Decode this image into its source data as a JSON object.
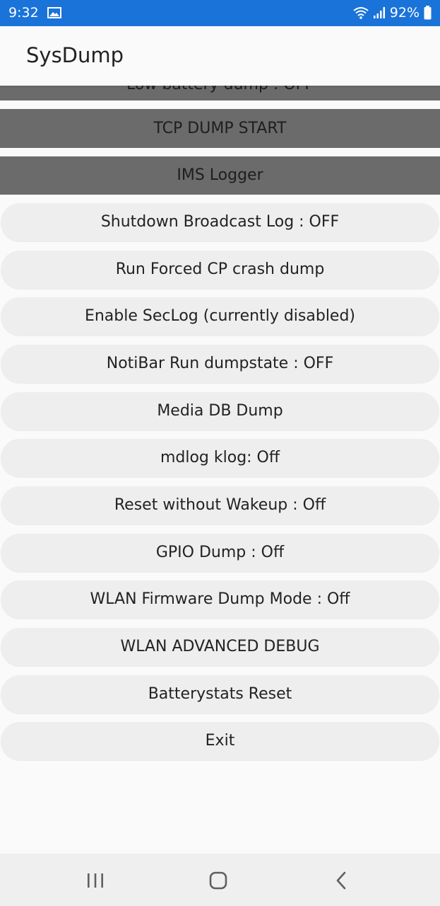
{
  "status_bar": {
    "time": "9:32",
    "battery_percent": "92%",
    "icons": [
      "photo-icon",
      "wifi-icon",
      "signal-icon",
      "battery-icon"
    ],
    "background": "#1a73d9"
  },
  "app_bar": {
    "title": "SysDump"
  },
  "buttons": {
    "low_battery": "Low battery dump : OFF",
    "tcp_dump": "TCP DUMP START",
    "ims_logger": "IMS Logger"
  },
  "pill_buttons": [
    "Shutdown Broadcast Log : OFF",
    "Run Forced CP crash dump",
    "Enable SecLog (currently disabled)",
    "NotiBar Run dumpstate : OFF",
    "Media DB Dump",
    "mdlog klog: Off",
    "Reset without Wakeup : Off",
    "GPIO Dump : Off",
    "WLAN Firmware Dump Mode : Off",
    "WLAN ADVANCED DEBUG",
    "Batterystats Reset",
    "Exit"
  ],
  "nav_bar": {
    "icons": [
      "recent-apps-icon",
      "home-icon",
      "back-icon"
    ]
  },
  "colors": {
    "dark_button": "#6b6b6b",
    "pill_button": "#eeeeee",
    "page_background": "#fafafa"
  }
}
